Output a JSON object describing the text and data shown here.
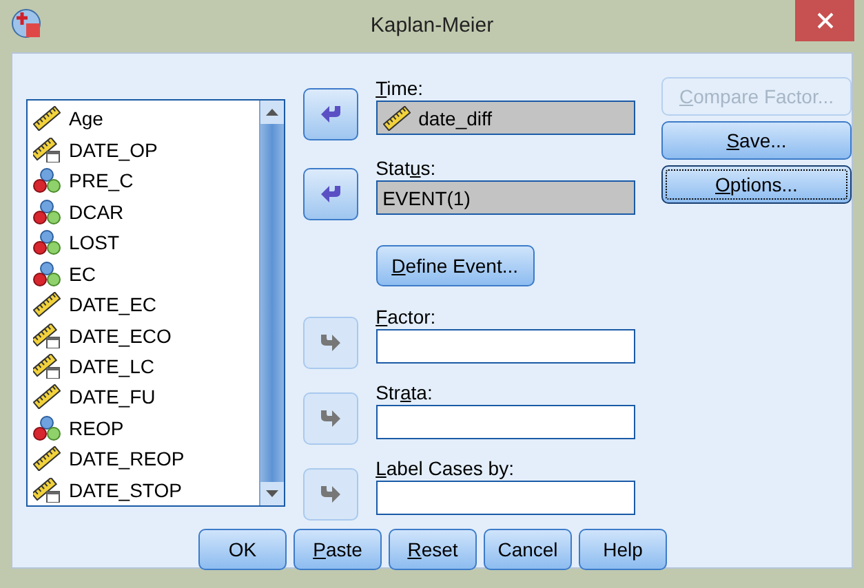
{
  "window": {
    "title": "Kaplan-Meier"
  },
  "variables": [
    {
      "name": "Age",
      "kind": "scale"
    },
    {
      "name": "DATE_OP",
      "kind": "date"
    },
    {
      "name": "PRE_C",
      "kind": "nominal"
    },
    {
      "name": "DCAR",
      "kind": "nominal"
    },
    {
      "name": "LOST",
      "kind": "nominal"
    },
    {
      "name": "EC",
      "kind": "nominal"
    },
    {
      "name": "DATE_EC",
      "kind": "scale"
    },
    {
      "name": "DATE_ECO",
      "kind": "date"
    },
    {
      "name": "DATE_LC",
      "kind": "date"
    },
    {
      "name": "DATE_FU",
      "kind": "scale"
    },
    {
      "name": "REOP",
      "kind": "nominal"
    },
    {
      "name": "DATE_REOP",
      "kind": "scale"
    },
    {
      "name": "DATE_STOP",
      "kind": "date"
    }
  ],
  "targets": [
    {
      "label": {
        "key": "T",
        "post": "ime:"
      },
      "kind": "left",
      "disabled": false,
      "value": {
        "text": "date_diff",
        "kind": "scale"
      }
    },
    {
      "label": {
        "pre": "Stat",
        "key": "u",
        "post": "s:"
      },
      "kind": "left",
      "disabled": false,
      "value": {
        "text": "EVENT(1)",
        "kind": "none"
      },
      "button": {
        "key": "D",
        "post": "efine Event..."
      }
    },
    {
      "label": {
        "key": "F",
        "post": "actor:"
      },
      "kind": "right",
      "disabled": true
    },
    {
      "label": {
        "pre": "Str",
        "key": "a",
        "post": "ta:"
      },
      "kind": "right",
      "disabled": true
    },
    {
      "label": {
        "key": "L",
        "post": "abel Cases by:"
      },
      "kind": "right",
      "disabled": true
    }
  ],
  "side_buttons": [
    {
      "label": {
        "key": "C",
        "post": "ompare Factor..."
      },
      "disabled": true,
      "focused": false
    },
    {
      "label": {
        "key": "S",
        "post": "ave..."
      },
      "disabled": false,
      "focused": false
    },
    {
      "label": {
        "key": "O",
        "post": "ptions..."
      },
      "disabled": false,
      "focused": true
    }
  ],
  "buttons": [
    {
      "label": {
        "pre": "OK"
      }
    },
    {
      "label": {
        "key": "P",
        "post": "aste"
      }
    },
    {
      "label": {
        "key": "R",
        "post": "eset"
      }
    },
    {
      "label": {
        "pre": "Cancel"
      }
    },
    {
      "label": {
        "pre": "Help"
      }
    }
  ]
}
